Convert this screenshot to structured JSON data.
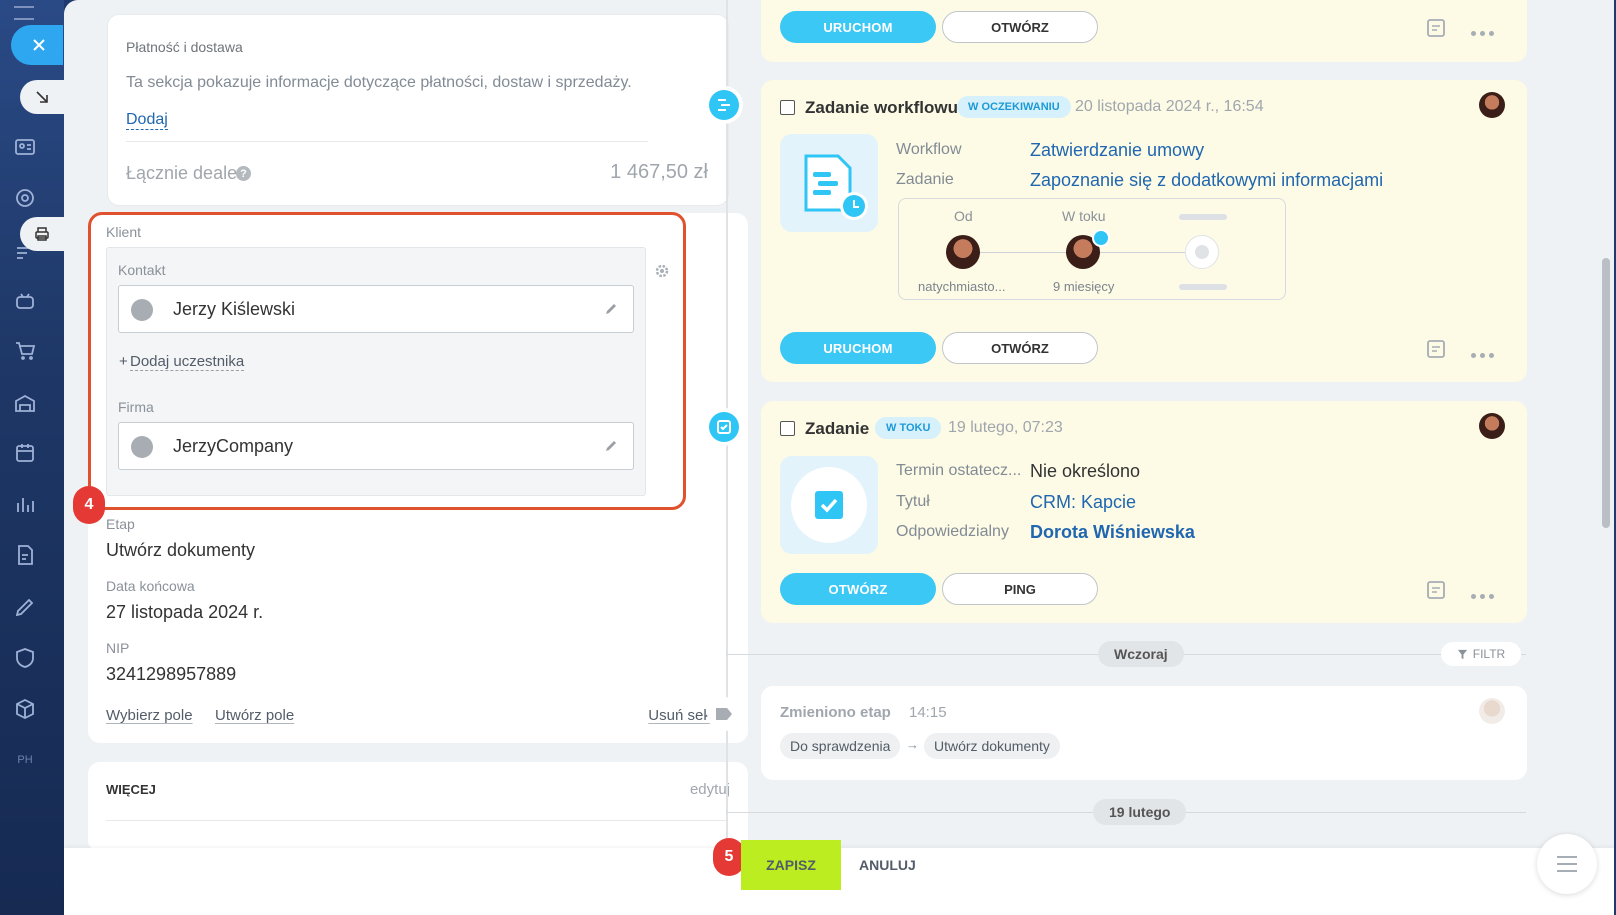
{
  "payment": {
    "title": "Płatność i dostawa",
    "description": "Ta sekcja pokazuje informacje dotyczące płatności, dostaw i sprzedaży.",
    "add_link": "Dodaj",
    "total_label": "Łącznie deale",
    "total_value": "1 467,50 zł"
  },
  "client": {
    "section_label": "Klient",
    "contact_label": "Kontakt",
    "contact_value": "Jerzy Kiślewski",
    "add_participant": "Dodaj uczestnika",
    "add_participant_plus": "+",
    "company_label": "Firma",
    "company_value": "JerzyCompany",
    "step_marker": "4"
  },
  "fields": {
    "stage_label": "Etap",
    "stage_value": "Utwórz dokumenty",
    "enddate_label": "Data końcowa",
    "enddate_value": "27 listopada 2024 r.",
    "nip_label": "NIP",
    "nip_value": "3241298957889",
    "select_field": "Wybierz pole",
    "create_field": "Utwórz pole",
    "delete_section": "Usuń sekcję"
  },
  "more": {
    "title": "WIĘCEJ",
    "edit": "edytuj"
  },
  "timeline": {
    "top_card": {
      "run": "URUCHOM",
      "open": "OTWÓRZ"
    },
    "workflow": {
      "title": "Zadanie workflowu",
      "badge": "W OCZEKIWANIU",
      "date": "20 listopada 2024 r., 16:54",
      "workflow_label": "Workflow",
      "workflow_value": "Zatwierdzanie umowy",
      "task_label": "Zadanie",
      "task_value": "Zapoznanie się z dodatkowymi informacjami",
      "from_label": "Od",
      "inprogress_label": "W toku",
      "from_user": "natychmiasto...",
      "duration": "9 miesięcy",
      "run": "URUCHOM",
      "open": "OTWÓRZ"
    },
    "task": {
      "title": "Zadanie",
      "badge": "W TOKU",
      "date": "19 lutego, 07:23",
      "deadline_label": "Termin ostatecz...",
      "deadline_value": "Nie określono",
      "title_label": "Tytuł",
      "title_value": "CRM: Kapcie",
      "resp_label": "Odpowiedzialny",
      "resp_value": "Dorota Wiśniewska",
      "open": "OTWÓRZ",
      "ping": "PING"
    },
    "yesterday": "Wczoraj",
    "filter": "FILTR",
    "stage_change": {
      "title": "Zmieniono etap",
      "time": "14:15",
      "from": "Do sprawdzenia",
      "arrow": "→",
      "to": "Utwórz dokumenty"
    },
    "day2": "19 lutego"
  },
  "bottom": {
    "step_marker": "5",
    "save": "ZAPISZ",
    "cancel": "ANULUJ"
  },
  "colors": {
    "accent_blue": "#3bc8f5",
    "save_green": "#bbed21",
    "highlight_red": "#e0522d",
    "link_blue": "#2067b0"
  },
  "icons": [
    "close-icon",
    "arrow-down-right-icon",
    "contact-card-icon",
    "target-icon",
    "printer-icon",
    "robot-icon",
    "cart-icon",
    "warehouse-icon",
    "calendar-icon",
    "chart-icon",
    "document-icon",
    "pen-icon",
    "shield-icon",
    "box-icon",
    "gear-icon",
    "person-icon",
    "building-icon",
    "pencil-icon",
    "workflow-icon",
    "task-check-icon",
    "note-icon",
    "more-icon",
    "filter-icon",
    "menu-icon",
    "tag-icon",
    "clock-icon"
  ]
}
